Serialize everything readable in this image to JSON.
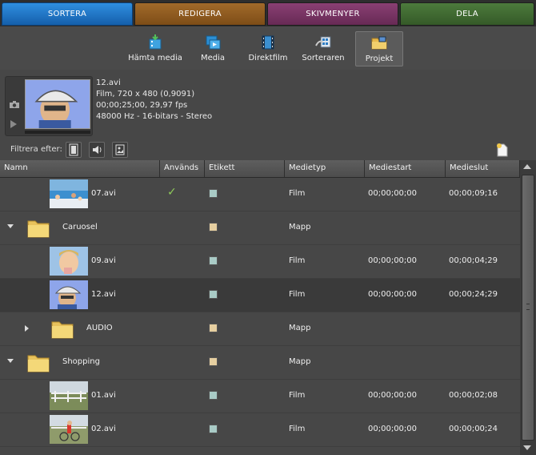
{
  "tabs": [
    {
      "label": "SORTERA"
    },
    {
      "label": "REDIGERA"
    },
    {
      "label": "SKIVMENYER"
    },
    {
      "label": "DELA"
    }
  ],
  "toolbar": [
    {
      "label": "Hämta media",
      "icon": "get-media-icon"
    },
    {
      "label": "Media",
      "icon": "media-icon"
    },
    {
      "label": "Direktfilm",
      "icon": "instant-movie-icon"
    },
    {
      "label": "Sorteraren",
      "icon": "organizer-icon"
    },
    {
      "label": "Projekt",
      "icon": "project-folder-icon",
      "selected": true
    }
  ],
  "preview": {
    "filename": "12.avi",
    "line2": "Film, 720 x 480 (0,9091)",
    "line3": "00;00;25;00, 29,97 fps",
    "line4": "48000 Hz - 16-bitars - Stereo"
  },
  "filter": {
    "label": "Filtrera efter:"
  },
  "columns": [
    "Namn",
    "Används",
    "Etikett",
    "Medietyp",
    "Mediestart",
    "Medieslut"
  ],
  "rows": [
    {
      "name": "07.avi",
      "used": "✓",
      "label_color": "#a9cbc6",
      "type": "Film",
      "start": "00;00;00;00",
      "end": "00;00;09;16",
      "kind": "clip",
      "thumb": "beach"
    },
    {
      "name": "Caruosel",
      "used": "",
      "label_color": "#e6cfa0",
      "type": "Mapp",
      "start": "",
      "end": "",
      "kind": "folder",
      "expanded": true
    },
    {
      "name": "09.avi",
      "used": "",
      "label_color": "#a9cbc6",
      "type": "Film",
      "start": "00;00;00;00",
      "end": "00;00;04;29",
      "kind": "clip",
      "thumb": "boy"
    },
    {
      "name": "12.avi",
      "used": "",
      "label_color": "#a9cbc6",
      "type": "Film",
      "start": "00;00;00;00",
      "end": "00;00;24;29",
      "kind": "clip",
      "thumb": "helmet",
      "selected": true
    },
    {
      "name": "AUDIO",
      "used": "",
      "label_color": "#e6cfa0",
      "type": "Mapp",
      "start": "",
      "end": "",
      "kind": "folder",
      "expanded": false
    },
    {
      "name": "Shopping",
      "used": "",
      "label_color": "#e6cfa0",
      "type": "Mapp",
      "start": "",
      "end": "",
      "kind": "folder",
      "expanded": true
    },
    {
      "name": "01.avi",
      "used": "",
      "label_color": "#a9cbc6",
      "type": "Film",
      "start": "00;00;00;00",
      "end": "00;00;02;08",
      "kind": "clip",
      "thumb": "fence"
    },
    {
      "name": "02.avi",
      "used": "",
      "label_color": "#a9cbc6",
      "type": "Film",
      "start": "00;00;00;00",
      "end": "00;00;00;24",
      "kind": "clip",
      "thumb": "bike"
    }
  ]
}
